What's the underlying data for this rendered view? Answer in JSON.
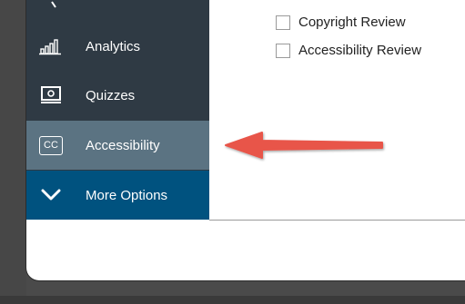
{
  "sidebar": {
    "items": [
      {
        "label": "Analytics",
        "icon": "bar-chart-icon"
      },
      {
        "label": "Quizzes",
        "icon": "monitor-icon"
      },
      {
        "label": "Accessibility",
        "icon": "cc-icon",
        "icon_text": "CC"
      },
      {
        "label": "More Options",
        "icon": "chevron-down-icon"
      }
    ]
  },
  "options": [
    {
      "label": "Copyright Review",
      "checked": false
    },
    {
      "label": "Accessibility Review",
      "checked": false
    }
  ],
  "colors": {
    "sidebar_bg": "#2f3a44",
    "selected_bg": "#5b7382",
    "more_options_bg": "#00527f",
    "arrow": "#e8554a"
  }
}
